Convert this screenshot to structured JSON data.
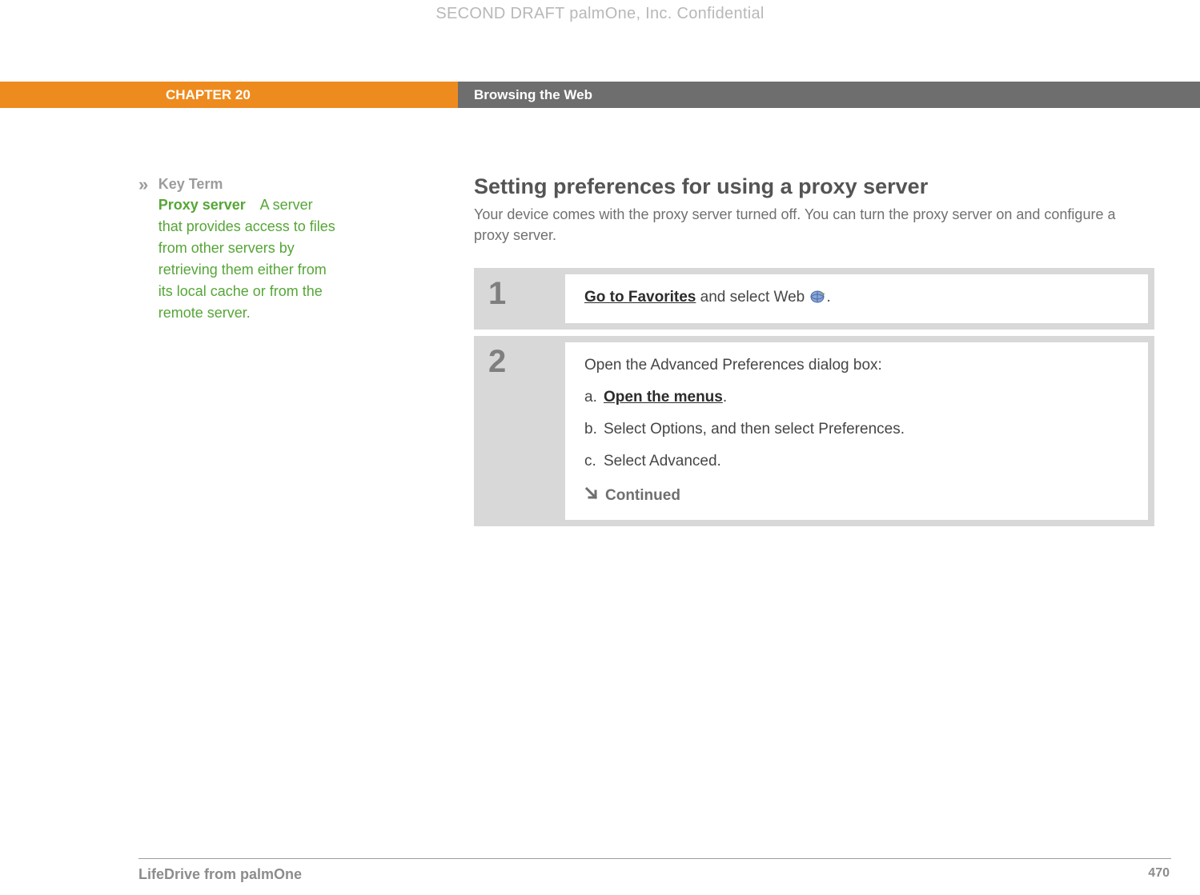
{
  "watermark": "SECOND DRAFT palmOne, Inc.  Confidential",
  "chapter": {
    "label": "CHAPTER 20",
    "title": "Browsing the Web"
  },
  "sidebar": {
    "marker": "»",
    "heading": "Key Term",
    "term": "Proxy server",
    "definition": "A server that provides access to files from other servers by retrieving them either from its local cache or from the remote server."
  },
  "section": {
    "title": "Setting preferences for using a proxy server",
    "intro": "Your device comes with the proxy server turned off. You can turn the proxy server on and configure a proxy server."
  },
  "steps": {
    "s1": {
      "num": "1",
      "link": "Go to Favorites",
      "text_after": " and select Web ",
      "period": "."
    },
    "s2": {
      "num": "2",
      "lead": "Open the Advanced Preferences dialog box:",
      "a_letter": "a.",
      "a_link": "Open the menus",
      "a_period": ".",
      "b_letter": "b.",
      "b_text": "Select Options, and then select Preferences.",
      "c_letter": "c.",
      "c_text": "Select Advanced.",
      "continued": "Continued"
    }
  },
  "footer": {
    "left": "LifeDrive from palmOne",
    "page": "470"
  }
}
